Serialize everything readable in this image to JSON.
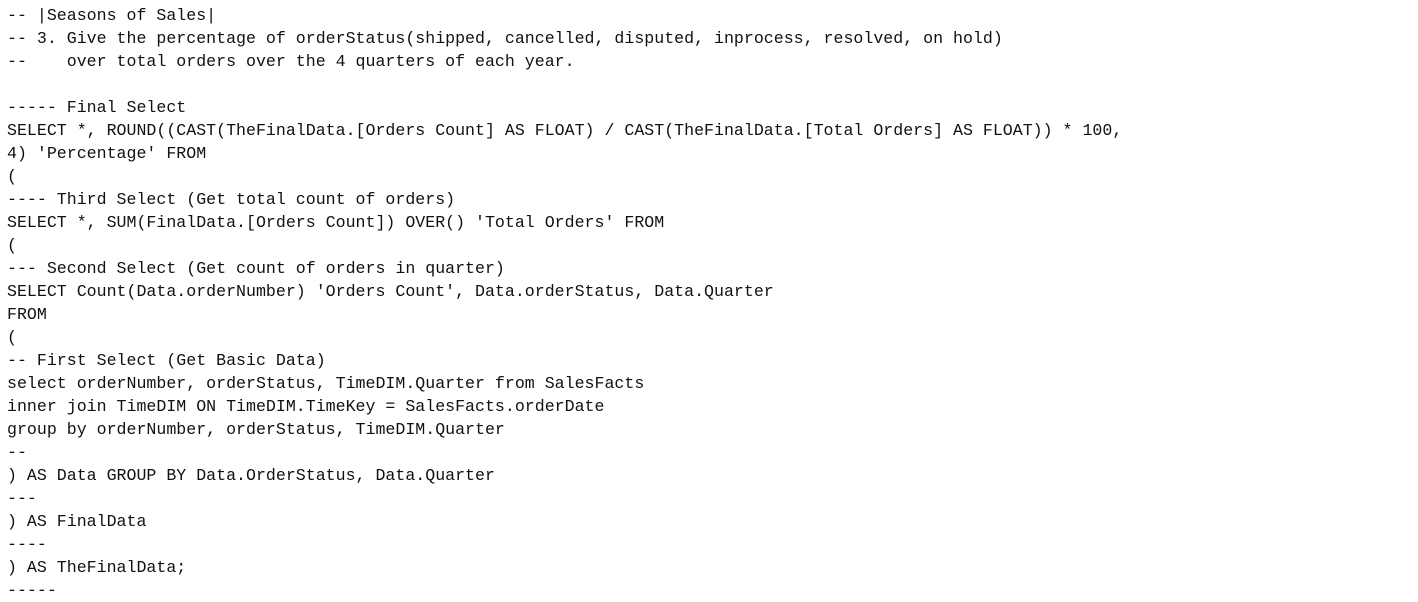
{
  "editor": {
    "lines": [
      "-- |Seasons of Sales|",
      "-- 3. Give the percentage of orderStatus(shipped, cancelled, disputed, inprocess, resolved, on hold)",
      "--    over total orders over the 4 quarters of each year.",
      "",
      "----- Final Select",
      "SELECT *, ROUND((CAST(TheFinalData.[Orders Count] AS FLOAT) / CAST(TheFinalData.[Total Orders] AS FLOAT)) * 100,",
      "4) 'Percentage' FROM",
      "(",
      "---- Third Select (Get total count of orders)",
      "SELECT *, SUM(FinalData.[Orders Count]) OVER() 'Total Orders' FROM",
      "(",
      "--- Second Select (Get count of orders in quarter)",
      "SELECT Count(Data.orderNumber) 'Orders Count', Data.orderStatus, Data.Quarter",
      "FROM",
      "(",
      "-- First Select (Get Basic Data)",
      "select orderNumber, orderStatus, TimeDIM.Quarter from SalesFacts",
      "inner join TimeDIM ON TimeDIM.TimeKey = SalesFacts.orderDate",
      "group by orderNumber, orderStatus, TimeDIM.Quarter",
      "--",
      ") AS Data GROUP BY Data.OrderStatus, Data.Quarter",
      "---",
      ") AS FinalData",
      "----",
      ") AS TheFinalData;",
      "-----"
    ]
  }
}
